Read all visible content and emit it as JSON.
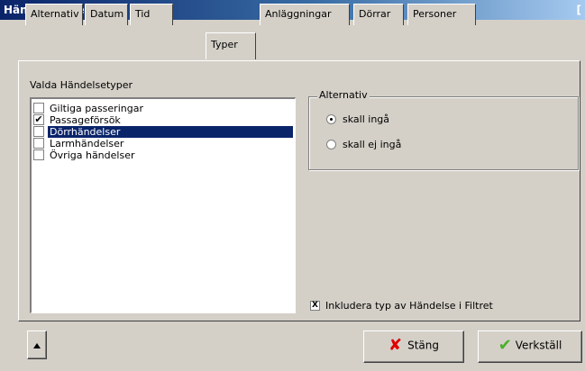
{
  "window": {
    "title": "Händelsefilter",
    "title_right": "["
  },
  "tabs": [
    {
      "label": "Alternativ"
    },
    {
      "label": "Datum"
    },
    {
      "label": "Tid"
    },
    {
      "label": "Typer"
    },
    {
      "label": "Anläggningar"
    },
    {
      "label": "Dörrar"
    },
    {
      "label": "Personer"
    }
  ],
  "active_tab": "Typer",
  "types": {
    "label": "Valda Händelsetyper",
    "items": [
      {
        "label": "Giltiga passeringar",
        "checked": false,
        "check_glyph": ""
      },
      {
        "label": "Passageförsök",
        "checked": true,
        "check_glyph": "✔"
      },
      {
        "label": "Dörrhändelser",
        "checked": false,
        "check_glyph": "",
        "selected": true
      },
      {
        "label": "Larmhändelser",
        "checked": false,
        "check_glyph": ""
      },
      {
        "label": "Övriga händelser",
        "checked": false,
        "check_glyph": ""
      }
    ]
  },
  "alternatives": {
    "legend": "Alternativ",
    "options": [
      {
        "label": "skall ingå",
        "checked": true
      },
      {
        "label": "skall ej ingå",
        "checked": false
      }
    ]
  },
  "include": {
    "label": "Inkludera typ av Händelse i Filtret",
    "checked": true,
    "glyph": "X"
  },
  "buttons": {
    "close_label": "Stäng",
    "apply_label": "Verkställ"
  },
  "colors": {
    "selection": "#0a246a",
    "close_icon": "#e00000",
    "apply_icon": "#4caf2a"
  }
}
